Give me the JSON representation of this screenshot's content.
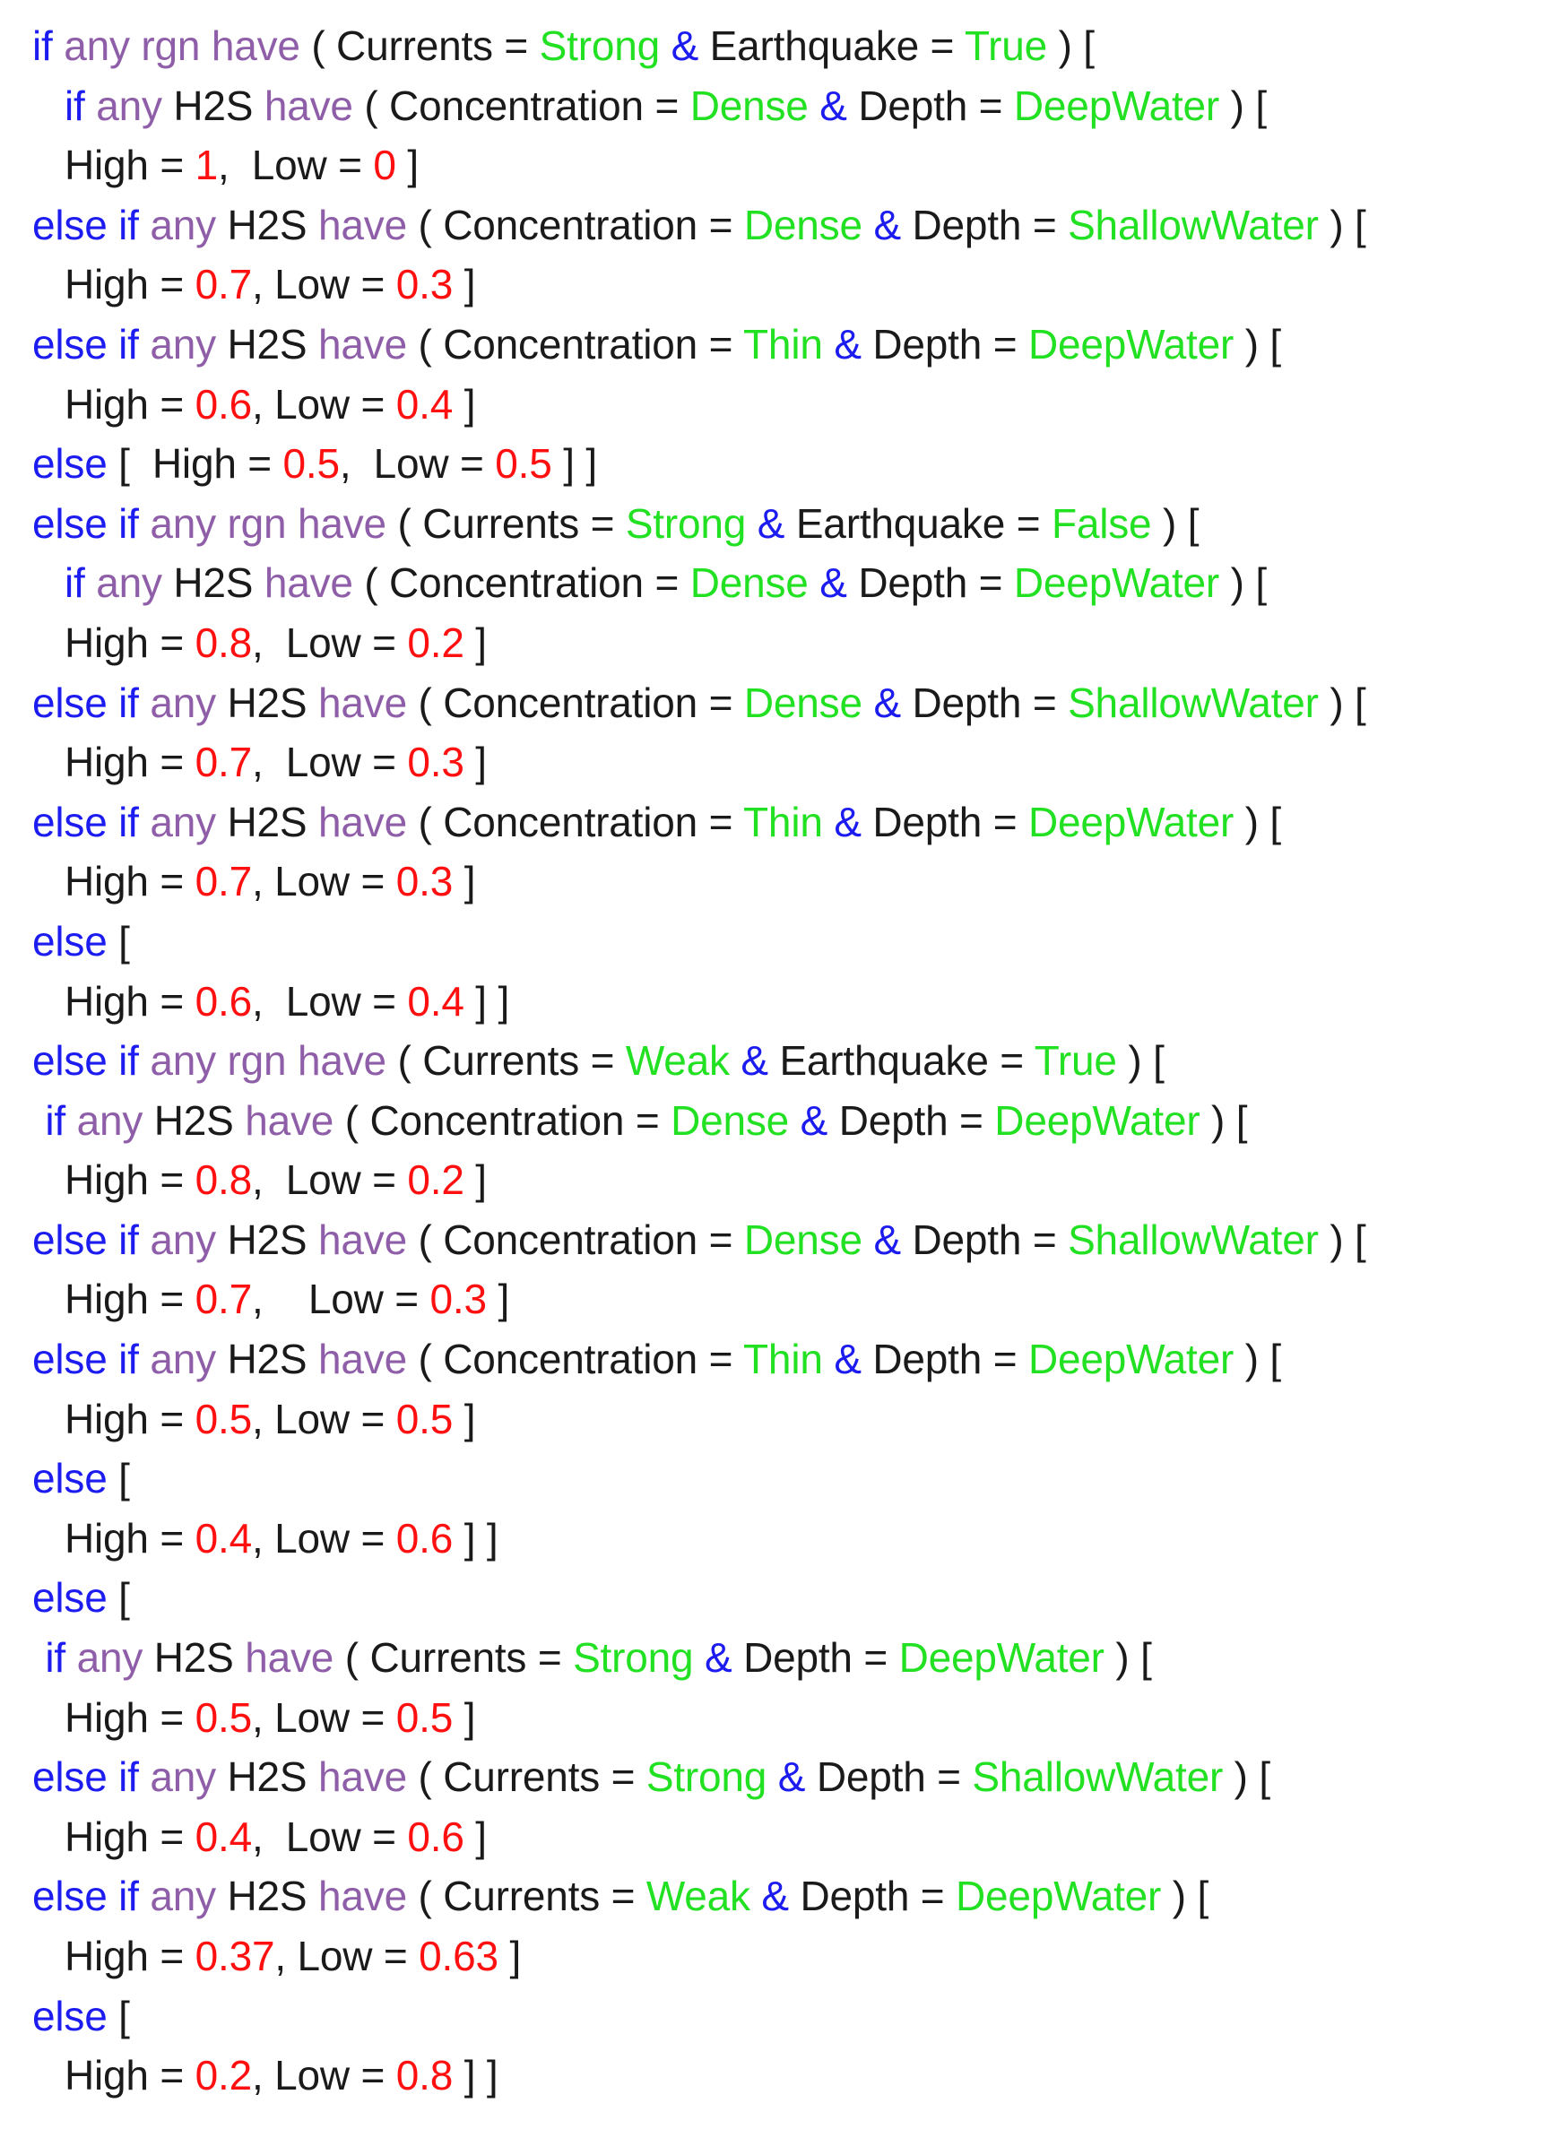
{
  "colors": {
    "background": "#ffffff",
    "keyword": "#1c1cf0",
    "quantifier": "#8f5ea8",
    "identifier": "#1a1a1a",
    "value": "#22e022",
    "number": "#ff1010"
  },
  "editor": {
    "lines": [
      {
        "indent": 1,
        "tokens": [
          [
            "kw",
            "if"
          ],
          [
            "sp",
            " "
          ],
          [
            "qt",
            "any rgn have"
          ],
          [
            "sp",
            " "
          ],
          [
            "id",
            "( Currents = "
          ],
          [
            "val",
            "Strong"
          ],
          [
            "sp",
            " "
          ],
          [
            "op",
            "&"
          ],
          [
            "id",
            " Earthquake = "
          ],
          [
            "val",
            "True"
          ],
          [
            "id",
            " ) ["
          ]
        ]
      },
      {
        "indent": 2,
        "tokens": [
          [
            "kw",
            "if"
          ],
          [
            "sp",
            " "
          ],
          [
            "qt",
            "any"
          ],
          [
            "id",
            " H2S "
          ],
          [
            "qt",
            "have"
          ],
          [
            "id",
            " ( Concentration = "
          ],
          [
            "val",
            "Dense"
          ],
          [
            "sp",
            " "
          ],
          [
            "op",
            "&"
          ],
          [
            "id",
            " Depth = "
          ],
          [
            "val",
            "DeepWater"
          ],
          [
            "id",
            " ) ["
          ]
        ]
      },
      {
        "indent": 2,
        "tokens": [
          [
            "id",
            "High = "
          ],
          [
            "num",
            "1"
          ],
          [
            "id",
            ",  Low = "
          ],
          [
            "num",
            "0"
          ],
          [
            "id",
            " ]"
          ]
        ]
      },
      {
        "indent": 1,
        "tokens": [
          [
            "kw",
            "else if"
          ],
          [
            "sp",
            " "
          ],
          [
            "qt",
            "any"
          ],
          [
            "id",
            " H2S "
          ],
          [
            "qt",
            "have"
          ],
          [
            "id",
            " ( Concentration = "
          ],
          [
            "val",
            "Dense"
          ],
          [
            "sp",
            " "
          ],
          [
            "op",
            "&"
          ],
          [
            "id",
            " Depth = "
          ],
          [
            "val",
            "ShallowWater"
          ],
          [
            "id",
            " ) ["
          ]
        ]
      },
      {
        "indent": 2,
        "tokens": [
          [
            "id",
            "High = "
          ],
          [
            "num",
            "0.7"
          ],
          [
            "id",
            ", Low = "
          ],
          [
            "num",
            "0.3"
          ],
          [
            "id",
            " ]"
          ]
        ]
      },
      {
        "indent": 1,
        "tokens": [
          [
            "kw",
            "else if"
          ],
          [
            "sp",
            " "
          ],
          [
            "qt",
            "any"
          ],
          [
            "id",
            " H2S "
          ],
          [
            "qt",
            "have"
          ],
          [
            "id",
            " ( Concentration = "
          ],
          [
            "val",
            "Thin"
          ],
          [
            "sp",
            " "
          ],
          [
            "op",
            "&"
          ],
          [
            "id",
            " Depth = "
          ],
          [
            "val",
            "DeepWater"
          ],
          [
            "id",
            " ) ["
          ]
        ]
      },
      {
        "indent": 2,
        "tokens": [
          [
            "id",
            "High = "
          ],
          [
            "num",
            "0.6"
          ],
          [
            "id",
            ", Low = "
          ],
          [
            "num",
            "0.4"
          ],
          [
            "id",
            " ]"
          ]
        ]
      },
      {
        "indent": 1,
        "tokens": [
          [
            "kw",
            "else"
          ],
          [
            "id",
            " [  High = "
          ],
          [
            "num",
            "0.5"
          ],
          [
            "id",
            ",  Low = "
          ],
          [
            "num",
            "0.5"
          ],
          [
            "id",
            " ] ]"
          ]
        ]
      },
      {
        "indent": 1,
        "tokens": [
          [
            "kw",
            "else if"
          ],
          [
            "sp",
            " "
          ],
          [
            "qt",
            "any rgn have"
          ],
          [
            "id",
            " ( Currents = "
          ],
          [
            "val",
            "Strong"
          ],
          [
            "sp",
            " "
          ],
          [
            "op",
            "&"
          ],
          [
            "id",
            " Earthquake = "
          ],
          [
            "val",
            "False"
          ],
          [
            "id",
            " ) ["
          ]
        ]
      },
      {
        "indent": 2,
        "tokens": [
          [
            "kw",
            "if"
          ],
          [
            "sp",
            " "
          ],
          [
            "qt",
            "any"
          ],
          [
            "id",
            " H2S "
          ],
          [
            "qt",
            "have"
          ],
          [
            "id",
            " ( Concentration = "
          ],
          [
            "val",
            "Dense"
          ],
          [
            "sp",
            " "
          ],
          [
            "op",
            "&"
          ],
          [
            "id",
            " Depth = "
          ],
          [
            "val",
            "DeepWater"
          ],
          [
            "id",
            " ) ["
          ]
        ]
      },
      {
        "indent": 2,
        "tokens": [
          [
            "id",
            "High = "
          ],
          [
            "num",
            "0.8"
          ],
          [
            "id",
            ",  Low = "
          ],
          [
            "num",
            "0.2"
          ],
          [
            "id",
            " ]"
          ]
        ]
      },
      {
        "indent": 1,
        "tokens": [
          [
            "kw",
            "else if"
          ],
          [
            "sp",
            " "
          ],
          [
            "qt",
            "any"
          ],
          [
            "id",
            " H2S "
          ],
          [
            "qt",
            "have"
          ],
          [
            "id",
            " ( Concentration = "
          ],
          [
            "val",
            "Dense"
          ],
          [
            "sp",
            " "
          ],
          [
            "op",
            "&"
          ],
          [
            "id",
            " Depth = "
          ],
          [
            "val",
            "ShallowWater"
          ],
          [
            "id",
            " ) ["
          ]
        ]
      },
      {
        "indent": 2,
        "tokens": [
          [
            "id",
            "High = "
          ],
          [
            "num",
            "0.7"
          ],
          [
            "id",
            ",  Low = "
          ],
          [
            "num",
            "0.3"
          ],
          [
            "id",
            " ]"
          ]
        ]
      },
      {
        "indent": 1,
        "tokens": [
          [
            "kw",
            "else if"
          ],
          [
            "sp",
            " "
          ],
          [
            "qt",
            "any"
          ],
          [
            "id",
            " H2S "
          ],
          [
            "qt",
            "have"
          ],
          [
            "id",
            " ( Concentration = "
          ],
          [
            "val",
            "Thin"
          ],
          [
            "sp",
            " "
          ],
          [
            "op",
            "&"
          ],
          [
            "id",
            " Depth = "
          ],
          [
            "val",
            "DeepWater"
          ],
          [
            "id",
            " ) ["
          ]
        ]
      },
      {
        "indent": 2,
        "tokens": [
          [
            "id",
            "High = "
          ],
          [
            "num",
            "0.7"
          ],
          [
            "id",
            ", Low = "
          ],
          [
            "num",
            "0.3"
          ],
          [
            "id",
            " ]"
          ]
        ]
      },
      {
        "indent": 1,
        "tokens": [
          [
            "kw",
            "else"
          ],
          [
            "id",
            " ["
          ]
        ]
      },
      {
        "indent": 2,
        "tokens": [
          [
            "id",
            "High = "
          ],
          [
            "num",
            "0.6"
          ],
          [
            "id",
            ",  Low = "
          ],
          [
            "num",
            "0.4"
          ],
          [
            "id",
            " ] ]"
          ]
        ]
      },
      {
        "indent": 1,
        "tokens": [
          [
            "kw",
            "else if"
          ],
          [
            "sp",
            " "
          ],
          [
            "qt",
            "any rgn have"
          ],
          [
            "id",
            " ( Currents = "
          ],
          [
            "val",
            "Weak"
          ],
          [
            "sp",
            " "
          ],
          [
            "op",
            "&"
          ],
          [
            "id",
            " Earthquake = "
          ],
          [
            "val",
            "True"
          ],
          [
            "id",
            " ) ["
          ]
        ]
      },
      {
        "indent": 1.4,
        "tokens": [
          [
            "kw",
            "if"
          ],
          [
            "sp",
            " "
          ],
          [
            "qt",
            "any"
          ],
          [
            "id",
            " H2S "
          ],
          [
            "qt",
            "have"
          ],
          [
            "id",
            " ( Concentration = "
          ],
          [
            "val",
            "Dense"
          ],
          [
            "sp",
            " "
          ],
          [
            "op",
            "&"
          ],
          [
            "id",
            " Depth = "
          ],
          [
            "val",
            "DeepWater"
          ],
          [
            "id",
            " ) ["
          ]
        ]
      },
      {
        "indent": 2,
        "tokens": [
          [
            "id",
            "High = "
          ],
          [
            "num",
            "0.8"
          ],
          [
            "id",
            ",  Low = "
          ],
          [
            "num",
            "0.2"
          ],
          [
            "id",
            " ]"
          ]
        ]
      },
      {
        "indent": 1,
        "tokens": [
          [
            "kw",
            "else if"
          ],
          [
            "sp",
            " "
          ],
          [
            "qt",
            "any"
          ],
          [
            "id",
            " H2S "
          ],
          [
            "qt",
            "have"
          ],
          [
            "id",
            " ( Concentration = "
          ],
          [
            "val",
            "Dense"
          ],
          [
            "sp",
            " "
          ],
          [
            "op",
            "&"
          ],
          [
            "id",
            " Depth = "
          ],
          [
            "val",
            "ShallowWater"
          ],
          [
            "id",
            " ) ["
          ]
        ]
      },
      {
        "indent": 2,
        "tokens": [
          [
            "id",
            "High = "
          ],
          [
            "num",
            "0.7"
          ],
          [
            "id",
            ",    Low = "
          ],
          [
            "num",
            "0.3"
          ],
          [
            "id",
            " ]"
          ]
        ]
      },
      {
        "indent": 1,
        "tokens": [
          [
            "kw",
            "else if"
          ],
          [
            "sp",
            " "
          ],
          [
            "qt",
            "any"
          ],
          [
            "id",
            " H2S "
          ],
          [
            "qt",
            "have"
          ],
          [
            "id",
            " ( Concentration = "
          ],
          [
            "val",
            "Thin"
          ],
          [
            "sp",
            " "
          ],
          [
            "op",
            "&"
          ],
          [
            "id",
            " Depth = "
          ],
          [
            "val",
            "DeepWater"
          ],
          [
            "id",
            " ) ["
          ]
        ]
      },
      {
        "indent": 2,
        "tokens": [
          [
            "id",
            "High = "
          ],
          [
            "num",
            "0.5"
          ],
          [
            "id",
            ", Low = "
          ],
          [
            "num",
            "0.5"
          ],
          [
            "id",
            " ]"
          ]
        ]
      },
      {
        "indent": 1,
        "tokens": [
          [
            "kw",
            "else"
          ],
          [
            "id",
            " ["
          ]
        ]
      },
      {
        "indent": 2,
        "tokens": [
          [
            "id",
            "High = "
          ],
          [
            "num",
            "0.4"
          ],
          [
            "id",
            ", Low = "
          ],
          [
            "num",
            "0.6"
          ],
          [
            "id",
            " ] ]"
          ]
        ]
      },
      {
        "indent": 1,
        "tokens": [
          [
            "kw",
            "else"
          ],
          [
            "id",
            " ["
          ]
        ]
      },
      {
        "indent": 1.4,
        "tokens": [
          [
            "kw",
            "if"
          ],
          [
            "sp",
            " "
          ],
          [
            "qt",
            "any"
          ],
          [
            "id",
            " H2S "
          ],
          [
            "qt",
            "have"
          ],
          [
            "id",
            " ( Currents = "
          ],
          [
            "val",
            "Strong"
          ],
          [
            "sp",
            " "
          ],
          [
            "op",
            "&"
          ],
          [
            "id",
            " Depth = "
          ],
          [
            "val",
            "DeepWater"
          ],
          [
            "id",
            " ) ["
          ]
        ]
      },
      {
        "indent": 2,
        "tokens": [
          [
            "id",
            "High = "
          ],
          [
            "num",
            "0.5"
          ],
          [
            "id",
            ", Low = "
          ],
          [
            "num",
            "0.5"
          ],
          [
            "id",
            " ]"
          ]
        ]
      },
      {
        "indent": 1,
        "tokens": [
          [
            "kw",
            "else if"
          ],
          [
            "sp",
            " "
          ],
          [
            "qt",
            "any"
          ],
          [
            "id",
            " H2S "
          ],
          [
            "qt",
            "have"
          ],
          [
            "id",
            " ( Currents = "
          ],
          [
            "val",
            "Strong"
          ],
          [
            "sp",
            " "
          ],
          [
            "op",
            "&"
          ],
          [
            "id",
            " Depth = "
          ],
          [
            "val",
            "ShallowWater"
          ],
          [
            "id",
            " ) ["
          ]
        ]
      },
      {
        "indent": 2,
        "tokens": [
          [
            "id",
            "High = "
          ],
          [
            "num",
            "0.4"
          ],
          [
            "id",
            ",  Low = "
          ],
          [
            "num",
            "0.6"
          ],
          [
            "id",
            " ]"
          ]
        ]
      },
      {
        "indent": 1,
        "tokens": [
          [
            "kw",
            "else if"
          ],
          [
            "sp",
            " "
          ],
          [
            "qt",
            "any"
          ],
          [
            "id",
            " H2S "
          ],
          [
            "qt",
            "have"
          ],
          [
            "id",
            " ( Currents = "
          ],
          [
            "val",
            "Weak"
          ],
          [
            "sp",
            " "
          ],
          [
            "op",
            "&"
          ],
          [
            "id",
            " Depth = "
          ],
          [
            "val",
            "DeepWater"
          ],
          [
            "id",
            " ) ["
          ]
        ]
      },
      {
        "indent": 2,
        "tokens": [
          [
            "id",
            "High = "
          ],
          [
            "num",
            "0.37"
          ],
          [
            "id",
            ", Low = "
          ],
          [
            "num",
            "0.63"
          ],
          [
            "id",
            " ]"
          ]
        ]
      },
      {
        "indent": 1,
        "tokens": [
          [
            "kw",
            "else"
          ],
          [
            "id",
            " ["
          ]
        ]
      },
      {
        "indent": 2,
        "tokens": [
          [
            "id",
            "High = "
          ],
          [
            "num",
            "0.2"
          ],
          [
            "id",
            ", Low = "
          ],
          [
            "num",
            "0.8"
          ],
          [
            "id",
            " ] ]"
          ]
        ]
      }
    ]
  }
}
